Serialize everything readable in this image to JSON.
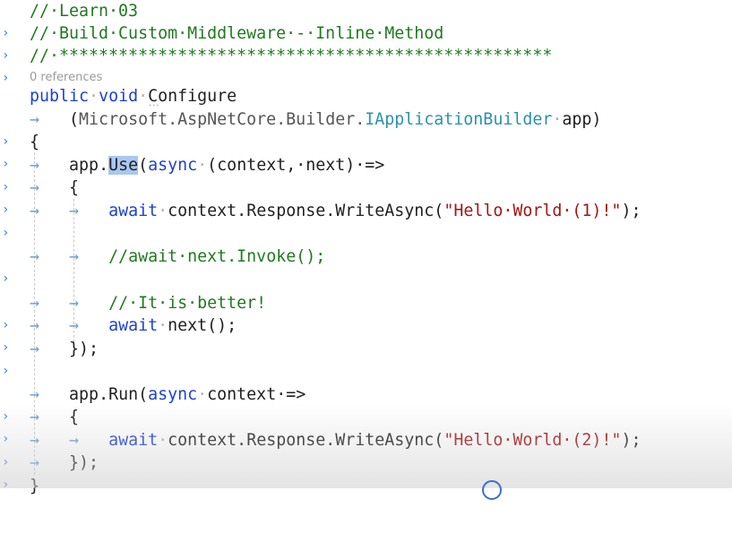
{
  "editor": {
    "comment_line1": "//·Learn·03",
    "comment_line2": "//·Build·Custom·Middleware·-·Inline·Method",
    "comment_line3": "//·**************************************************",
    "code_lens": "0 references",
    "sig_kw1": "public",
    "sig_kw2": "void",
    "sig_name": "Configure",
    "param_ns": "Microsoft.AspNetCore.Builder.",
    "param_type": "IApplicationBuilder",
    "param_name": "app",
    "use_prefix": "app.",
    "use_method": "Use",
    "use_async": "async",
    "use_args": "(context,·next)·=>",
    "await_kw": "await",
    "write_call": "context.Response.WriteAsync(",
    "hello1": "\"Hello·World·(1)!\"",
    "comment_invoke": "//await·next.Invoke();",
    "comment_better": "//·It·is·better!",
    "next_call": "next();",
    "close_use": "});",
    "run_prefix": "app.Run(",
    "run_async": "async",
    "run_args": "context·=>",
    "hello2": "\"Hello·World·(2)!\"",
    "close_run": "});",
    "open_brace": "{",
    "close_brace": "}",
    "call_end": ");",
    "tab_glyph": "→",
    "space_glyph": "·",
    "margin_glyph": "›"
  }
}
